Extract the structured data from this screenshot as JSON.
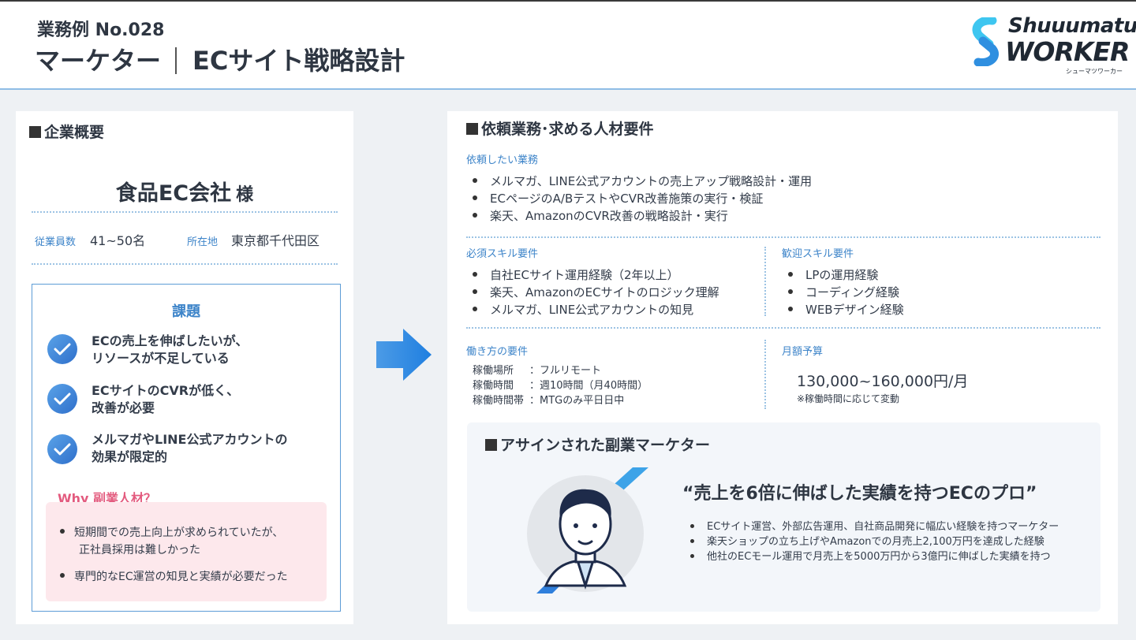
{
  "header": {
    "case_no": "業務例 No.028",
    "role": "マーケター",
    "project": "ECサイト戦略設計"
  },
  "logo": {
    "line1": "Shuuumatu",
    "line2": "WORKER",
    "sub": "シューマツワーカー",
    "icon": "s-mark-icon",
    "colors": {
      "blue": "#2f8fe0",
      "cyan": "#3ec6f0"
    }
  },
  "company": {
    "section_title": "企業概要",
    "name": "食品EC会社",
    "honorific": "様",
    "employees_label": "従業員数",
    "employees_value": "41~50名",
    "location_label": "所在地",
    "location_value": "東京都千代田区"
  },
  "issues": {
    "title": "課題",
    "items": [
      {
        "line1": "ECの売上を伸ばしたいが、",
        "line2": "リソースが不足している"
      },
      {
        "line1": "ECサイトのCVRが低く、",
        "line2": "改善が必要"
      },
      {
        "line1": "メルマガやLINE公式アカウントの",
        "line2": "効果が限定的"
      }
    ],
    "why_title": "Why 副業人材？",
    "why_items": [
      {
        "line1": "短期間での売上向上が求められていたが、",
        "line2": "正社員採用は難しかった"
      },
      {
        "line1": "専門的なEC運営の知見と実績が必要だった"
      }
    ]
  },
  "requirements": {
    "section_title": "依頼業務･求める人材要件",
    "tasks_label": "依頼したい業務",
    "tasks": [
      "メルマガ、LINE公式アカウントの売上アップ戦略設計・運用",
      "ECページのA/BテストやCVR改善施策の実行・検証",
      "楽天、AmazonのCVR改善の戦略設計・実行"
    ],
    "required_label": "必須スキル要件",
    "required": [
      "自社ECサイト運用経験（2年以上）",
      "楽天、AmazonのECサイトのロジック理解",
      "メルマガ、LINE公式アカウントの知見"
    ],
    "welcome_label": "歓迎スキル要件",
    "welcome": [
      "LPの運用経験",
      "コーディング経験",
      "WEBデザイン経験"
    ],
    "work_label": "働き方の要件",
    "work": [
      {
        "k": "稼働場所",
        "v": "：フルリモート"
      },
      {
        "k": "稼働時間",
        "v": "：週10時間（月40時間）"
      },
      {
        "k": "稼働時間帯",
        "v": "：MTGのみ平日日中"
      }
    ],
    "budget_label": "月額予算",
    "budget_value": "130,000~160,000円/月",
    "budget_note": "※稼働時間に応じて変動"
  },
  "assigned": {
    "section_title": "アサインされた副業マーケター",
    "quote": "“売上を6倍に伸ばした実績を持つECのプロ”",
    "items": [
      "ECサイト運営、外部広告運用、自社商品開発に幅広い経験を持つマーケター",
      "楽天ショップの立ち上げやAmazonでの月売上2,100万円を達成した経験",
      "他社のECモール運用で月売上を5000万円から3億円に伸ばした実績を持つ"
    ]
  }
}
